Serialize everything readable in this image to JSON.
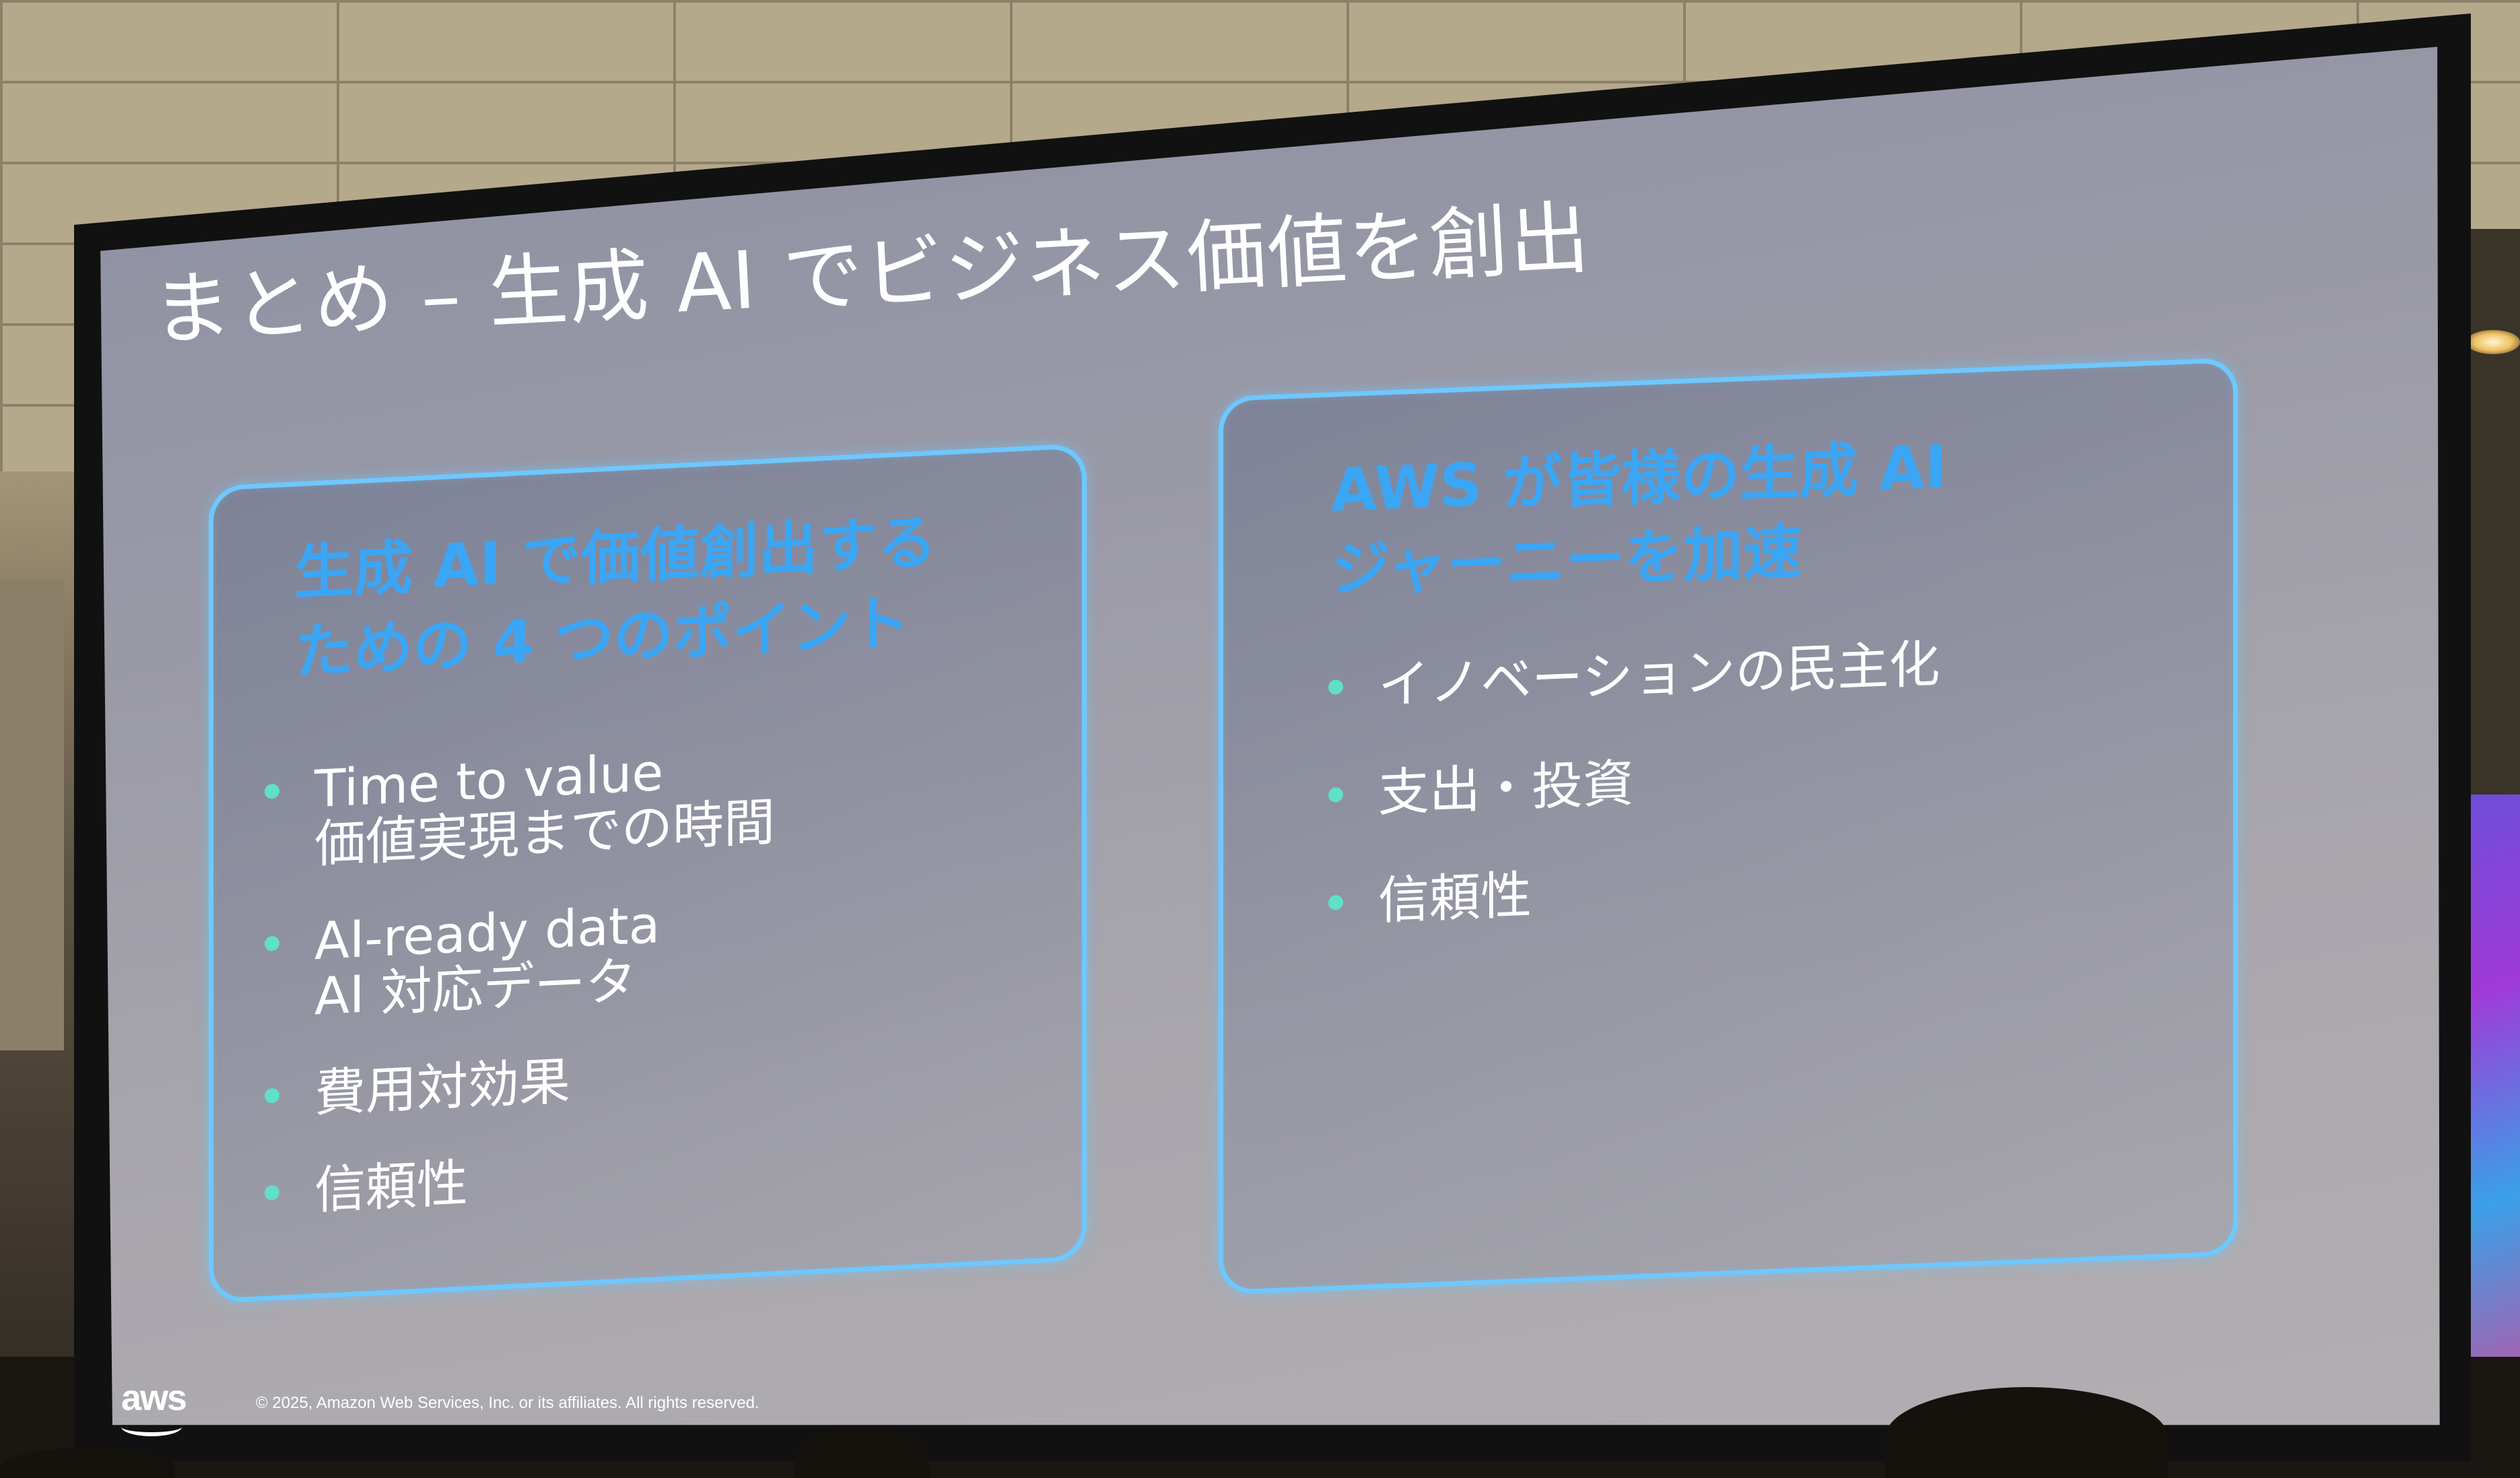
{
  "slide": {
    "title": "まとめ – 生成 AI でビジネス価値を創出",
    "left_panel": {
      "heading_line1": "生成 AI で価値創出する",
      "heading_line2": "ための 4 つのポイント",
      "items": [
        {
          "line1": "Time to value",
          "line2": "価値実現までの時間"
        },
        {
          "line1": "AI-ready data",
          "line2": "AI 対応データ"
        },
        {
          "line1": "費用対効果",
          "line2": ""
        },
        {
          "line1": "信頼性",
          "line2": ""
        }
      ]
    },
    "right_panel": {
      "heading_line1": "AWS が皆様の生成 AI",
      "heading_line2": "ジャーニーを加速",
      "items": [
        {
          "line1": "イノベーションの民主化"
        },
        {
          "line1": "支出・投資"
        },
        {
          "line1": "信頼性"
        }
      ]
    },
    "footer": {
      "logo_text": "aws",
      "copyright": "© 2025, Amazon Web Services, Inc. or its affiliates. All rights reserved."
    }
  },
  "colors": {
    "heading_accent": "#3aa6f5",
    "panel_border": "#6ec8ff",
    "bullet_dot": "#5fe0c8",
    "slide_text": "#ffffff"
  }
}
